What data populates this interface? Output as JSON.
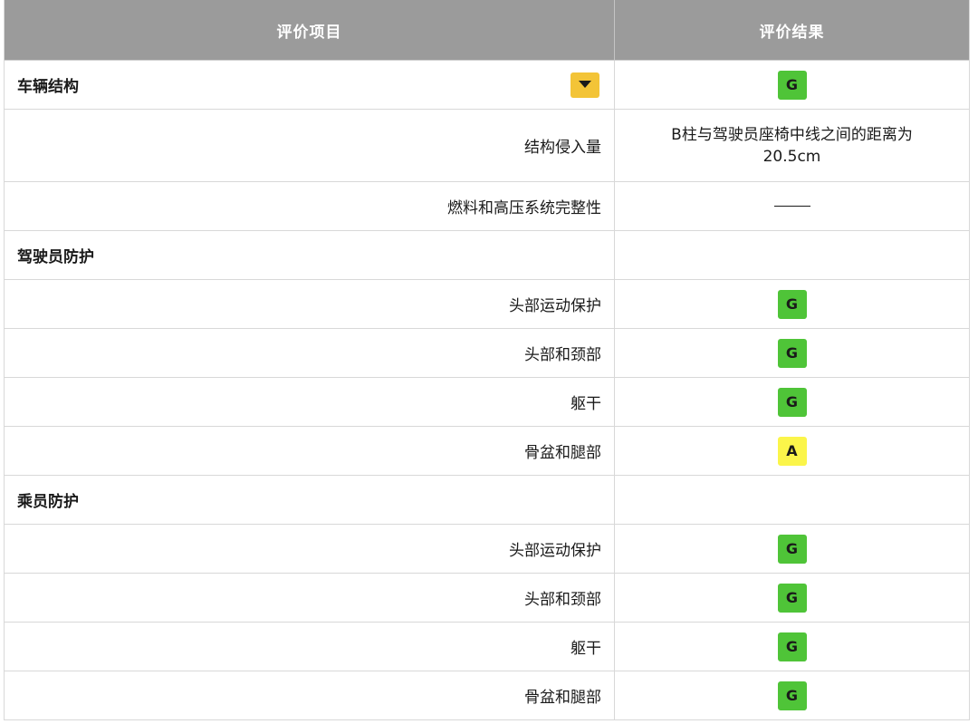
{
  "header": {
    "item_col": "评价项目",
    "result_col": "评价结果"
  },
  "colors": {
    "header_bg": "#9b9b9b",
    "good": "#4fc438",
    "acceptable": "#fbf54a",
    "dropdown": "#f3c437"
  },
  "sections": [
    {
      "title": "车辆结构",
      "result": "G",
      "icon": "chevron-down-icon",
      "rows": [
        {
          "label": "结构侵入量",
          "result_line1": "B柱与驾驶员座椅中线之间的距离为",
          "result_line2": "20.5cm"
        },
        {
          "label": "燃料和高压系统完整性",
          "result": "——"
        }
      ]
    },
    {
      "title": "驾驶员防护",
      "rows": [
        {
          "label": "头部运动保护",
          "result": "G"
        },
        {
          "label": "头部和颈部",
          "result": "G"
        },
        {
          "label": "躯干",
          "result": "G"
        },
        {
          "label": "骨盆和腿部",
          "result": "A"
        }
      ]
    },
    {
      "title": "乘员防护",
      "rows": [
        {
          "label": "头部运动保护",
          "result": "G"
        },
        {
          "label": "头部和颈部",
          "result": "G"
        },
        {
          "label": "躯干",
          "result": "G"
        },
        {
          "label": "骨盆和腿部",
          "result": "G"
        }
      ]
    }
  ]
}
